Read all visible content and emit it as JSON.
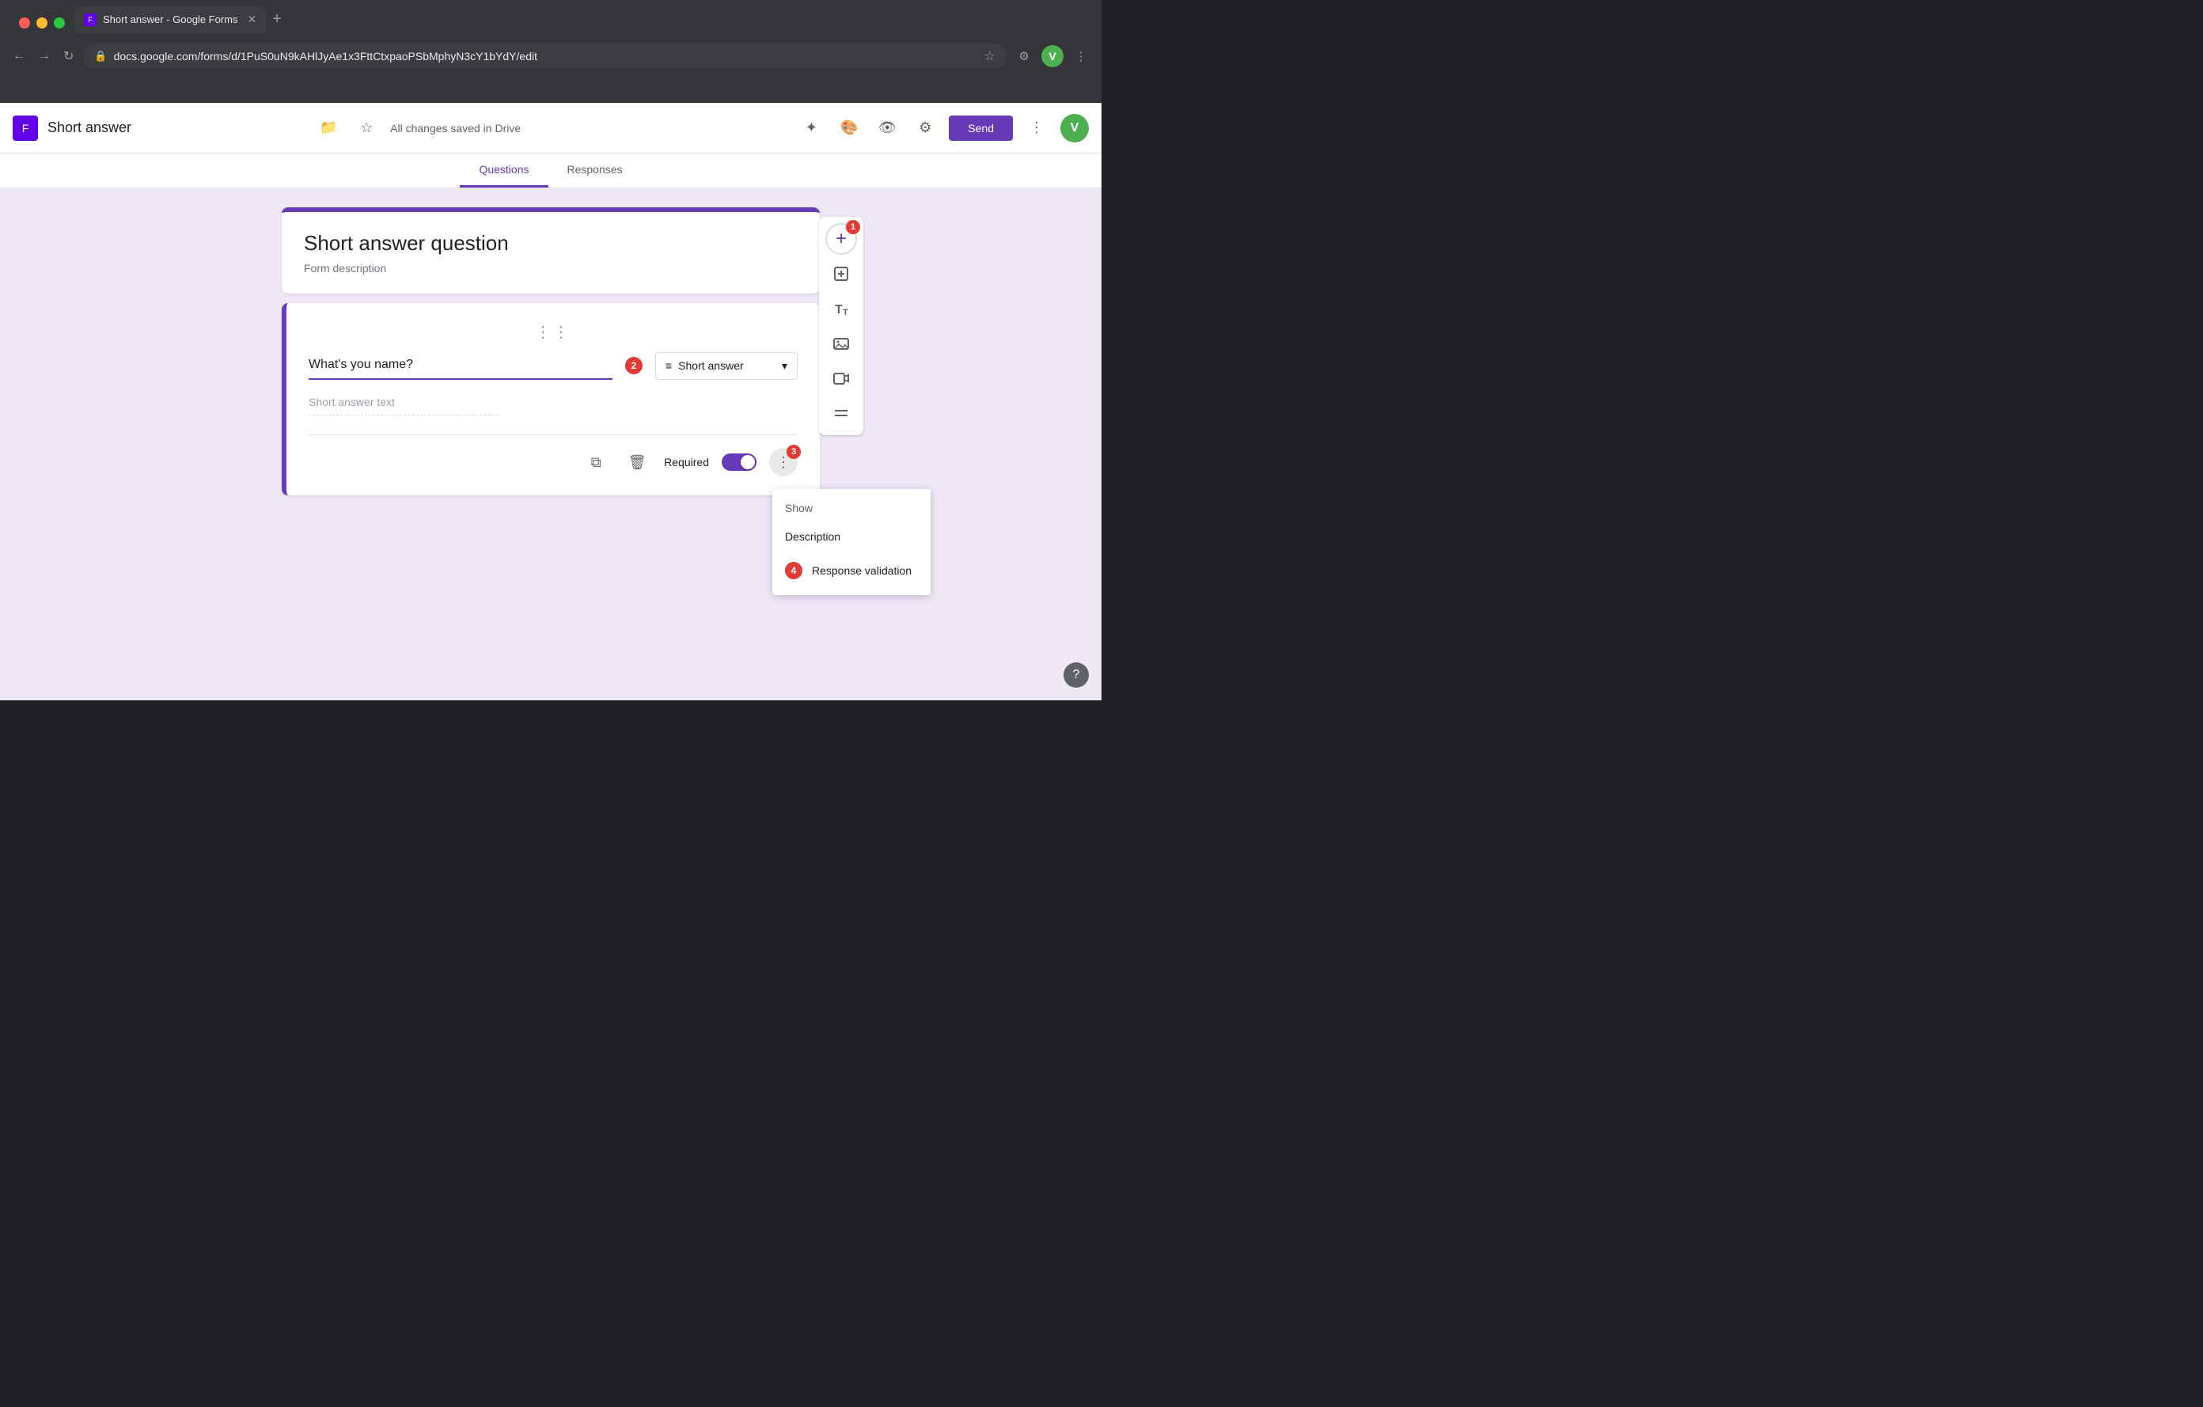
{
  "browser": {
    "url": "docs.google.com/forms/d/1PuS0uN9kAHlJyAe1x3FttCtxpaoPSbMphyN3cY1bYdY/edit",
    "tab_title": "Short answer - Google Forms",
    "tab_new_label": "+",
    "back_btn": "←",
    "forward_btn": "→",
    "refresh_btn": "↻"
  },
  "header": {
    "title": "Short answer",
    "saved_text": "All changes saved in Drive",
    "send_label": "Send",
    "avatar_letter": "V"
  },
  "tabs": {
    "questions_label": "Questions",
    "responses_label": "Responses"
  },
  "form": {
    "title": "Short answer question",
    "description": "Form description",
    "question_text": "What's you name?",
    "answer_type": "Short answer",
    "answer_placeholder": "Short answer text",
    "required_label": "Required",
    "drag_handle": "⋮⋮"
  },
  "badges": {
    "b1": "1",
    "b2": "2",
    "b3": "3",
    "b4": "4"
  },
  "dropdown": {
    "show_label": "Show",
    "description_label": "Description",
    "response_validation_label": "Response validation"
  },
  "sidebar": {
    "add_icon": "+",
    "copy_icon": "⧉",
    "title_icon": "T",
    "image_icon": "🖼",
    "video_icon": "▶",
    "section_icon": "▬"
  }
}
